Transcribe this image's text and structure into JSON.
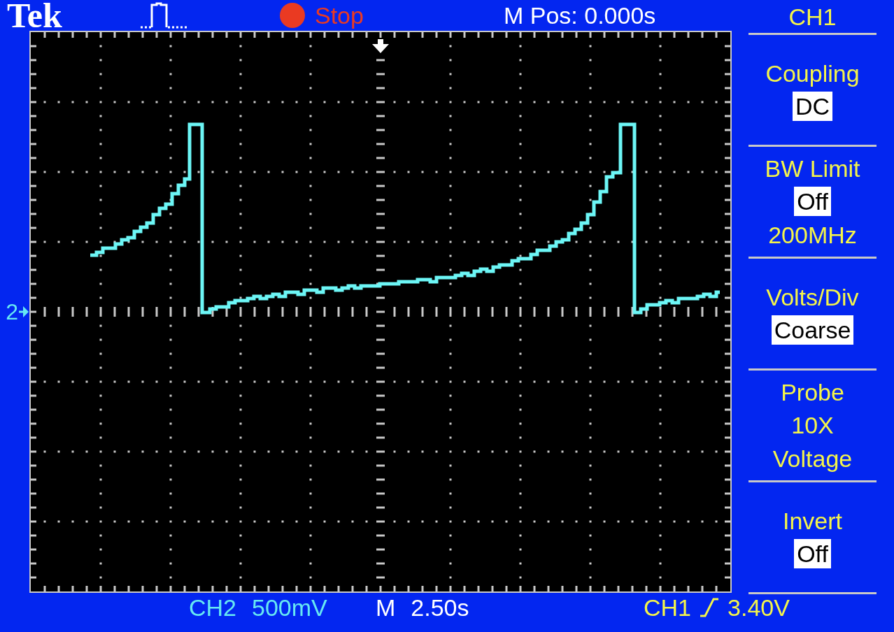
{
  "header": {
    "brand": "Tek",
    "acquisition": {
      "label": "Stop",
      "running": false
    },
    "position": "M Pos: 0.000s"
  },
  "display": {
    "channel_marker": "2"
  },
  "menu": {
    "title": "CH1",
    "sections": [
      {
        "label": "Coupling",
        "lines": [
          {
            "text": "DC",
            "highlighted": true
          }
        ]
      },
      {
        "label": "BW Limit",
        "lines": [
          {
            "text": "Off",
            "highlighted": true
          },
          {
            "text": "200MHz",
            "highlighted": false
          }
        ]
      },
      {
        "label": "Volts/Div",
        "lines": [
          {
            "text": "Coarse",
            "highlighted": true
          }
        ]
      },
      {
        "label": "Probe",
        "lines": [
          {
            "text": "10X",
            "highlighted": false
          },
          {
            "text": "Voltage",
            "highlighted": false
          }
        ]
      },
      {
        "label": "Invert",
        "lines": [
          {
            "text": "Off",
            "highlighted": true
          }
        ]
      }
    ]
  },
  "readouts": [
    {
      "kind": "channel",
      "name": "CH2",
      "value": "500mV"
    },
    {
      "kind": "timebase",
      "name": "M",
      "value": "2.50s"
    },
    {
      "kind": "trigger",
      "name": "CH1",
      "rising": true,
      "value": "3.40V"
    }
  ]
}
